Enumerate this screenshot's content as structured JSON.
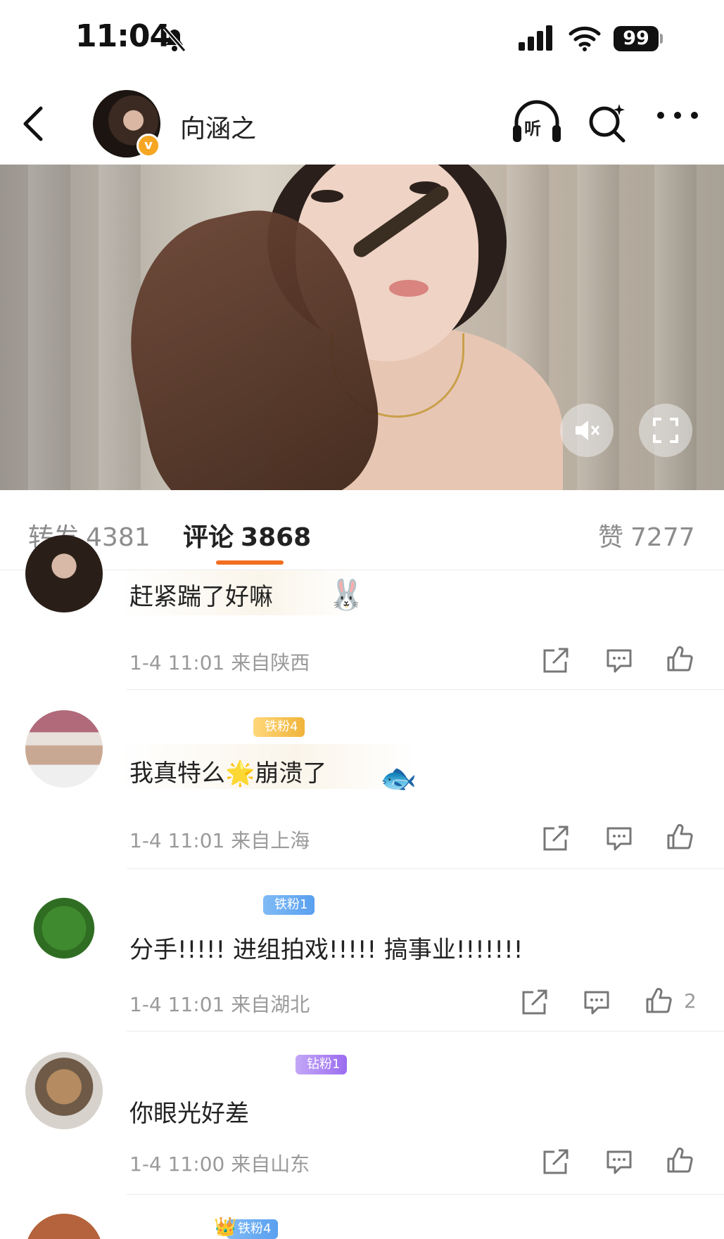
{
  "status_bar": {
    "time": "11:04",
    "battery": "99"
  },
  "header": {
    "username": "向涵之",
    "listen_label": "听"
  },
  "stats": {
    "repost_label": "转发",
    "repost_count": "4381",
    "comment_label": "评论",
    "comment_count": "3868",
    "like_label": "赞",
    "like_count": "7277"
  },
  "comments": [
    {
      "text": "赶紧踹了好嘛",
      "meta": "1-4 11:01 来自陕西",
      "fan_badge": "",
      "likes": ""
    },
    {
      "text_a": "我真特么",
      "text_b": "崩溃了",
      "meta": "1-4 11:01 来自上海",
      "fan_badge": "铁粉4",
      "likes": ""
    },
    {
      "text": "分手!!!!!  进组拍戏!!!!!  搞事业!!!!!!!",
      "meta": "1-4 11:01 来自湖北",
      "fan_badge": "铁粉1",
      "likes": "2"
    },
    {
      "text": "你眼光好差",
      "meta": "1-4 11:00 来自山东",
      "fan_badge": "钻粉1",
      "likes": ""
    },
    {
      "text": "",
      "meta": "",
      "fan_badge": "铁粉4",
      "likes": ""
    }
  ],
  "colors": {
    "accent": "#f26f21",
    "verified": "#f6a623",
    "iron_fan": "#5aa0f0",
    "diamond_fan": "#9b6cf0",
    "gold_fan": "#f0b43a"
  }
}
